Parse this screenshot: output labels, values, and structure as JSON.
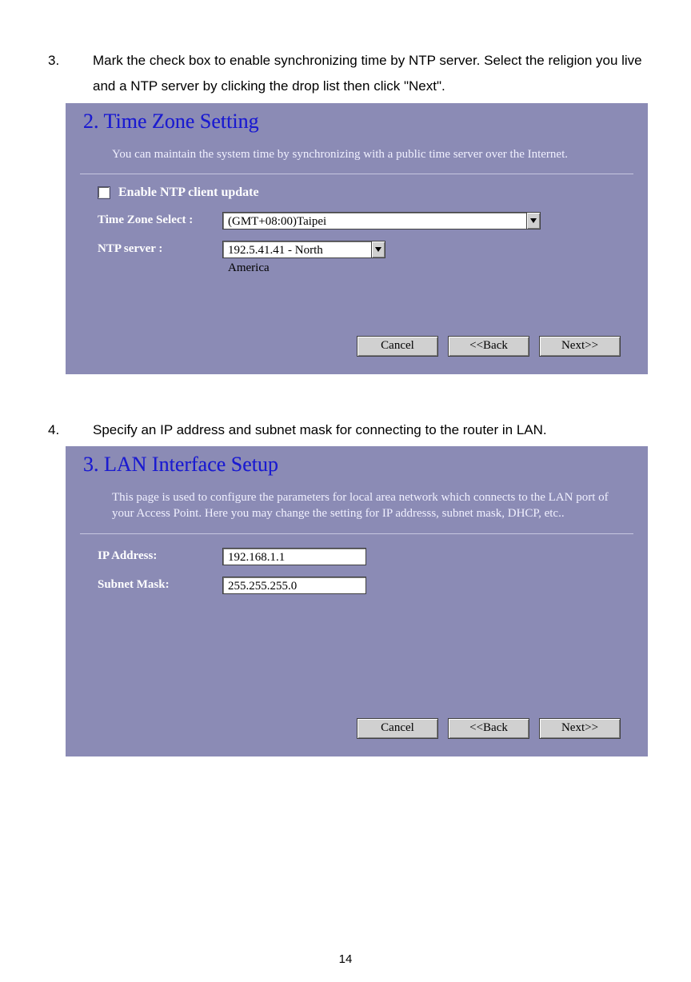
{
  "steps": {
    "s3": {
      "num": "3.",
      "text": "Mark the check box to enable synchronizing time by NTP server. Select the religion you live and a NTP server by clicking the drop list then click \"Next\"."
    },
    "s4": {
      "num": "4.",
      "text": "Specify an IP address and subnet mask for connecting to the router in LAN."
    }
  },
  "panel1": {
    "heading": "2. Time Zone Setting",
    "desc": "You can maintain the system time by synchronizing with a public time server over the Internet.",
    "enable_label": "Enable NTP client update",
    "timezone_label": "Time Zone Select :",
    "timezone_value": "(GMT+08:00)Taipei",
    "ntp_label": "NTP server :",
    "ntp_value": "192.5.41.41 - North America"
  },
  "panel2": {
    "heading": "3. LAN Interface Setup",
    "desc": "This page is used to configure the parameters for local area network which connects to the LAN port of your Access Point. Here you may change the setting for IP addresss, subnet mask, DHCP, etc..",
    "ip_label": "IP Address:",
    "ip_value": "192.168.1.1",
    "mask_label": "Subnet Mask:",
    "mask_value": "255.255.255.0"
  },
  "buttons": {
    "cancel": "Cancel",
    "back": "<<Back",
    "next": "Next>>"
  },
  "page_number": "14"
}
